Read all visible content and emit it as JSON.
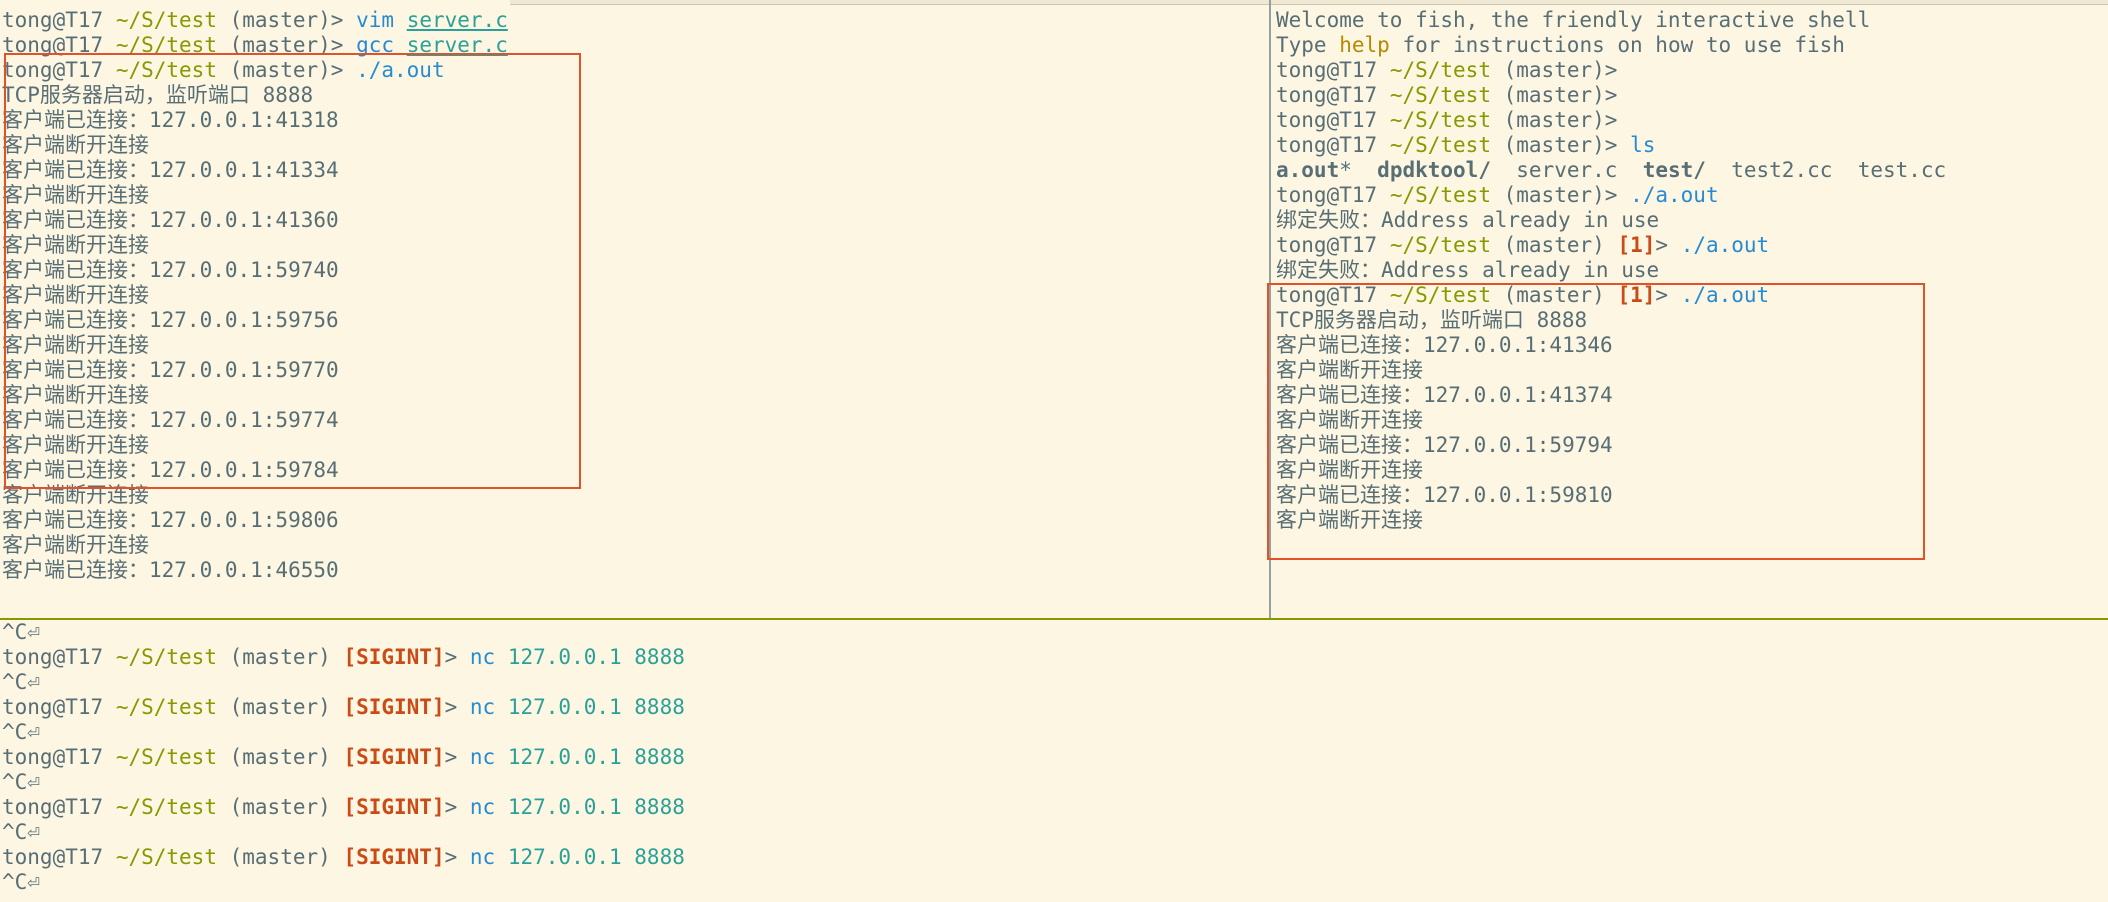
{
  "prompt": {
    "user_host": "tong@T17",
    "path": "~/S/test",
    "branch": "(master)",
    "arrow": ">",
    "status_1": "[1]",
    "sigint": "[SIGINT]"
  },
  "left_pane": {
    "cmd1": {
      "cmd": "vim",
      "arg": "server.c"
    },
    "cmd2": {
      "cmd": "gcc",
      "arg": "server.c"
    },
    "cmd3": {
      "cmd": "./a.out"
    },
    "server_start": "TCP服务器启动，监听端口 8888",
    "log": [
      "客户端已连接：127.0.0.1:41318",
      "客户端断开连接",
      "客户端已连接：127.0.0.1:41334",
      "客户端断开连接",
      "客户端已连接：127.0.0.1:41360",
      "客户端断开连接",
      "客户端已连接：127.0.0.1:59740",
      "客户端断开连接",
      "客户端已连接：127.0.0.1:59756",
      "客户端断开连接",
      "客户端已连接：127.0.0.1:59770",
      "客户端断开连接",
      "客户端已连接：127.0.0.1:59774",
      "客户端断开连接",
      "客户端已连接：127.0.0.1:59784",
      "客户端断开连接",
      "客户端已连接：127.0.0.1:59806",
      "客户端断开连接",
      "客户端已连接：127.0.0.1:46550"
    ]
  },
  "right_pane": {
    "welcome": "Welcome to fish, the friendly interactive shell",
    "help_pre": "Type ",
    "help_word": "help",
    "help_post": " for instructions on how to use fish",
    "ls_cmd": "ls",
    "ls_items": [
      "a.out",
      "*",
      "dpdktool/",
      "server.c",
      "test/",
      "test2.cc",
      "test.cc"
    ],
    "run_cmd": "./a.out",
    "bind_fail": "绑定失败：Address already in use",
    "server_start": "TCP服务器启动，监听端口 8888",
    "log": [
      "客户端已连接：127.0.0.1:41346",
      "客户端断开连接",
      "客户端已连接：127.0.0.1:41374",
      "客户端断开连接",
      "客户端已连接：127.0.0.1:59794",
      "客户端断开连接",
      "客户端已连接：127.0.0.1:59810",
      "客户端断开连接"
    ]
  },
  "bottom_pane": {
    "ctrl_c": "^C⏎",
    "nc_cmd": "nc",
    "nc_args": "127.0.0.1 8888"
  },
  "colors": {
    "background": "#fdf6e3",
    "path": "#859900",
    "command": "#268bd2",
    "argument": "#2aa198",
    "status": "#cb4b16",
    "help": "#b58900",
    "highlight_box": "#e0522b"
  }
}
